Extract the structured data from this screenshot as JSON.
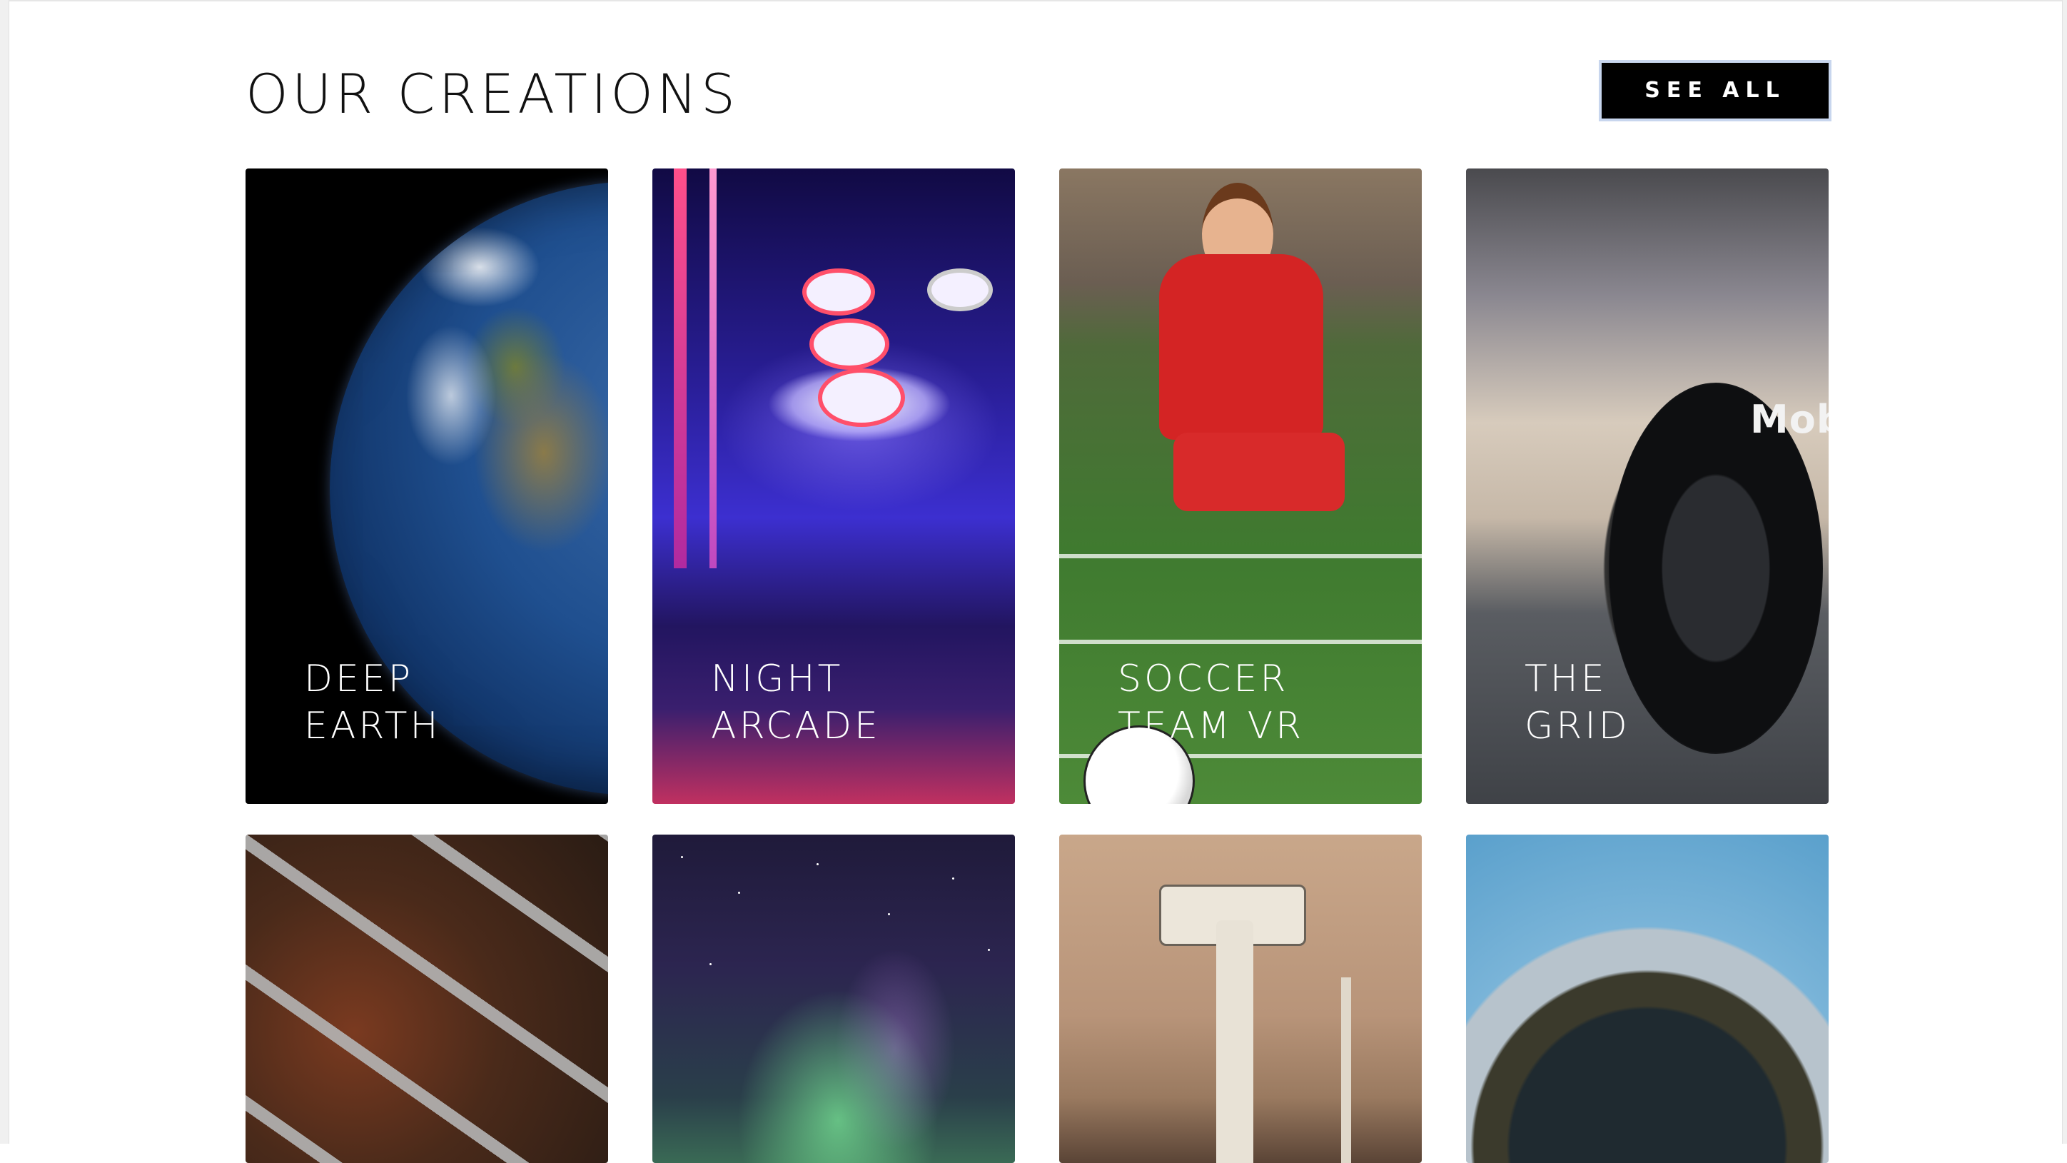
{
  "section": {
    "title": "OUR CREATIONS",
    "see_all_label": "SEE ALL"
  },
  "cards": [
    {
      "line1": "DEEP",
      "line2": "EARTH",
      "image": "earth-from-space"
    },
    {
      "line1": "NIGHT",
      "line2": "ARCADE",
      "image": "skee-ball-arcade"
    },
    {
      "line1": "SOCCER",
      "line2": "TEAM VR",
      "image": "soccer-player"
    },
    {
      "line1": "THE",
      "line2": "GRID",
      "image": "race-car"
    },
    {
      "image": "winding-roads-aerial"
    },
    {
      "image": "aurora-night-sky"
    },
    {
      "image": "mars-rover"
    },
    {
      "image": "tiny-planet-panorama"
    }
  ],
  "colors": {
    "background": "#ffffff",
    "button_bg": "#000000",
    "button_border": "#c8d6ee",
    "title_text": "#111111",
    "card_label_text": "#ffffff"
  }
}
